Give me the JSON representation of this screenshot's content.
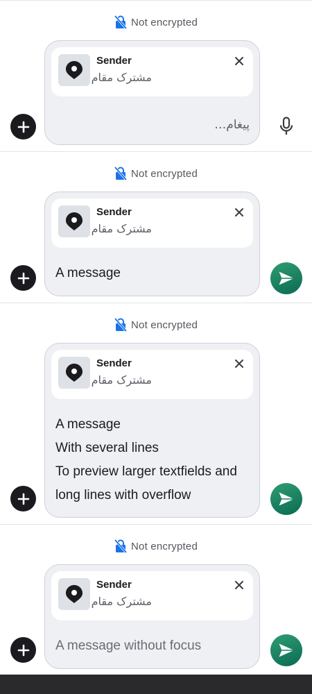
{
  "encryption_label": "Not encrypted",
  "reply_preview": {
    "sender": "Sender",
    "location_label": "مشترک مقام"
  },
  "composers": [
    {
      "message": "پیغام…",
      "state": "empty-placeholder",
      "action": "mic-icon"
    },
    {
      "message": "A message",
      "state": "single-line",
      "action": "send-icon"
    },
    {
      "message_lines": [
        "A message",
        "With several lines",
        "To preview larger textfields and",
        "long lines with overflow"
      ],
      "state": "multi-line",
      "action": "send-icon"
    },
    {
      "message": "A message without focus",
      "state": "unfocused-placeholder",
      "action": "send-icon"
    }
  ],
  "colors": {
    "send_button": "#1a8062",
    "add_button": "#1b1b1f",
    "card_background": "#eff0f4",
    "lock_icon": "#1a73e8"
  }
}
